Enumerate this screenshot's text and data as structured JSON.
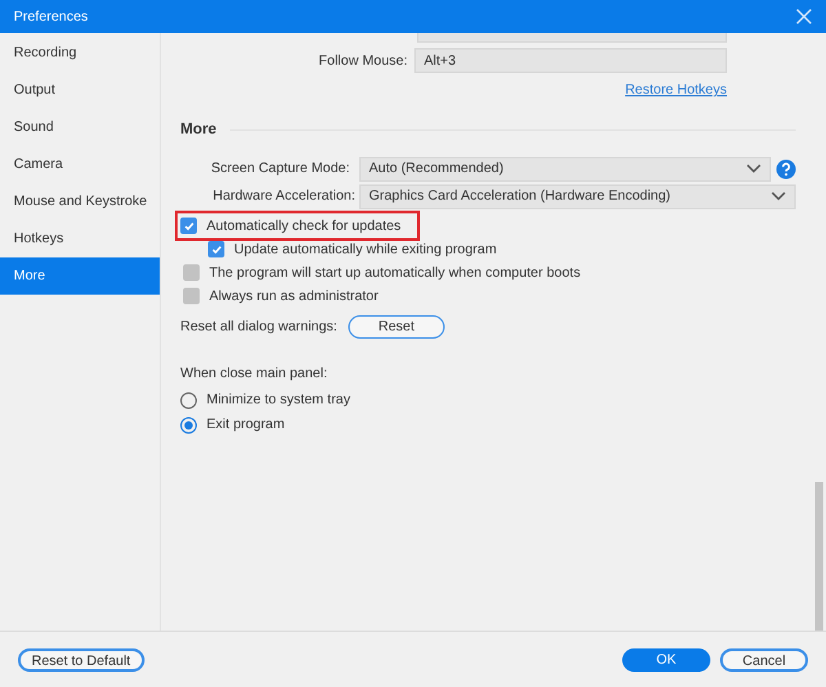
{
  "window": {
    "title": "Preferences"
  },
  "sidebar": {
    "items": [
      {
        "label": "Recording",
        "selected": false
      },
      {
        "label": "Output",
        "selected": false
      },
      {
        "label": "Sound",
        "selected": false
      },
      {
        "label": "Camera",
        "selected": false
      },
      {
        "label": "Mouse and Keystroke",
        "selected": false
      },
      {
        "label": "Hotkeys",
        "selected": false
      },
      {
        "label": "More",
        "selected": true
      }
    ]
  },
  "hotkeys": {
    "follow_mouse": {
      "label": "Follow Mouse:",
      "value": "Alt+3"
    },
    "restore_link": "Restore Hotkeys"
  },
  "more": {
    "heading": "More",
    "screen_capture_mode": {
      "label": "Screen Capture Mode:",
      "value": "Auto (Recommended)"
    },
    "hardware_acceleration": {
      "label": "Hardware Acceleration:",
      "value": "Graphics Card Acceleration (Hardware Encoding)"
    },
    "checkboxes": [
      {
        "label": "Automatically check for updates",
        "checked": true,
        "highlighted": true,
        "children": [
          {
            "label": "Update automatically while exiting program",
            "checked": true,
            "highlighted": false
          }
        ]
      },
      {
        "label": "The program will start up automatically when computer boots",
        "checked": false,
        "highlighted": false
      },
      {
        "label": "Always run as administrator",
        "checked": false,
        "highlighted": false
      }
    ],
    "reset_warnings": {
      "label": "Reset all dialog warnings:",
      "button": "Reset"
    },
    "close_panel": {
      "label": "When close main panel:",
      "options": [
        {
          "label": "Minimize to system tray",
          "selected": false
        },
        {
          "label": "Exit program",
          "selected": true
        }
      ]
    }
  },
  "footer": {
    "reset_default": "Reset to Default",
    "ok": "OK",
    "cancel": "Cancel"
  }
}
